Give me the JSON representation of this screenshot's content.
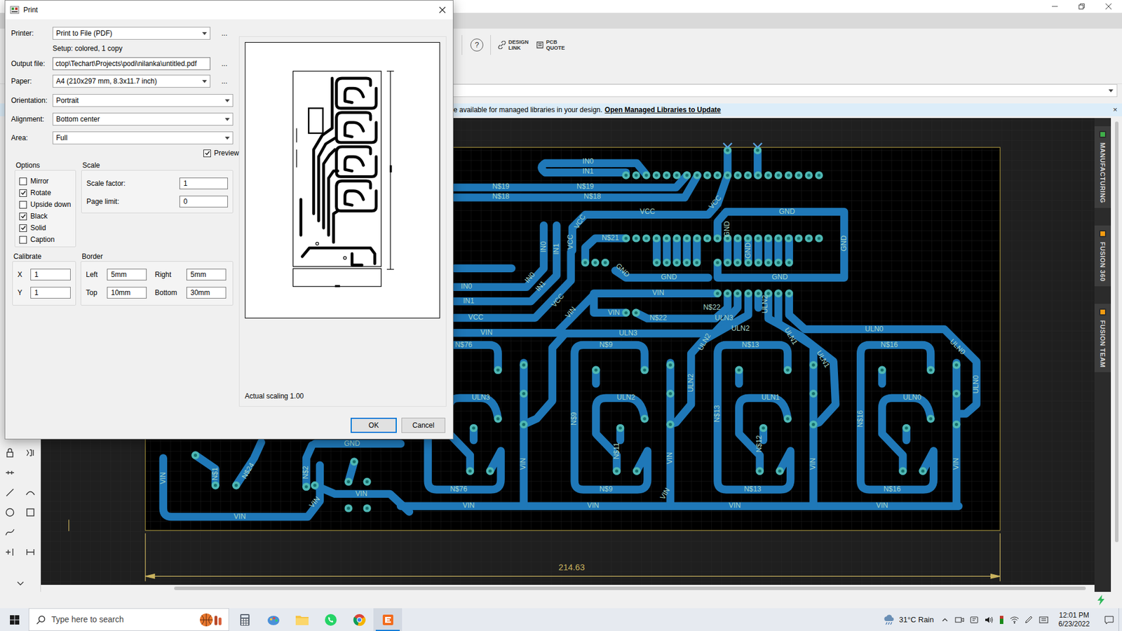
{
  "main_window": {
    "toolbar": {
      "help": "?",
      "buttons": [
        {
          "lines": [
            "DESIGN",
            "LINK"
          ]
        },
        {
          "lines": [
            "PCB",
            "QUOTE"
          ]
        }
      ]
    },
    "info_bar": {
      "text": "e available for managed libraries in your design.",
      "link": "Open Managed Libraries to Update",
      "close": "×"
    },
    "side_tabs": [
      {
        "label": "MANUFACTURING",
        "color": "#3fae49"
      },
      {
        "label": "FUSION 360",
        "color": "#f39c12"
      },
      {
        "label": "FUSION TEAM",
        "color": "#f39c12"
      }
    ],
    "pcb": {
      "labels": [
        "IN0",
        "IN1",
        "N$19",
        "N$19",
        "N$18",
        "N$18",
        "VCC",
        "VCC",
        "GND",
        "GND",
        "N$21",
        "GND",
        "GND",
        "IN0",
        "IN1",
        "VCC",
        "VCC",
        "GND",
        "GND",
        "GND",
        "IN0",
        "IN1",
        "IN0",
        "IN1",
        "VCC",
        "VCC",
        "VIN",
        "VIN",
        "VIN",
        "N$22",
        "N$22",
        "ULN3",
        "VIN",
        "ULN3",
        "ULN2",
        "ULN2",
        "ULN2",
        "ULN1",
        "ULN1",
        "ULN0",
        "ULN0",
        "N$76",
        "N$9",
        "N$13",
        "N$16",
        "ULN3",
        "ULN2",
        "ULN1",
        "ULN0",
        "ULN2",
        "ULN0",
        "N$9",
        "N$13",
        "N$16",
        "N$11",
        "N$12",
        "VIN",
        "VIN",
        "VIN",
        "VIN",
        "GND",
        "VIN",
        "N$1",
        "N$24",
        "N$2",
        "VIN",
        "N$76",
        "N$9",
        "N$13",
        "N$16",
        "VIN",
        "VIN",
        "VIN",
        "VIN",
        "VIN",
        "VIN",
        "VIN"
      ],
      "dimension": "214.63"
    }
  },
  "print_dialog": {
    "title": "Print",
    "printer": {
      "label": "Printer:",
      "value": "Print to File (PDF)",
      "more": "..."
    },
    "setup": "Setup: colored, 1 copy",
    "output_file": {
      "label": "Output file:",
      "value": "ctop\\Techart\\Projects\\podi\\nilanka\\untitled.pdf",
      "more": "..."
    },
    "paper": {
      "label": "Paper:",
      "value": "A4 (210x297 mm, 8.3x11.7 inch)",
      "more": "..."
    },
    "orientation": {
      "label": "Orientation:",
      "value": "Portrait"
    },
    "alignment": {
      "label": "Alignment:",
      "value": "Bottom center"
    },
    "area": {
      "label": "Area:",
      "value": "Full"
    },
    "preview": {
      "label": "Preview",
      "checked": true
    },
    "options": {
      "title": "Options",
      "items": [
        {
          "label": "Mirror",
          "checked": false
        },
        {
          "label": "Rotate",
          "checked": true
        },
        {
          "label": "Upside down",
          "checked": false
        },
        {
          "label": "Black",
          "checked": true
        },
        {
          "label": "Solid",
          "checked": true
        },
        {
          "label": "Caption",
          "checked": false
        }
      ]
    },
    "scale": {
      "title": "Scale",
      "fields": [
        {
          "label": "Scale factor:",
          "value": "1"
        },
        {
          "label": "Page limit:",
          "value": "0"
        }
      ]
    },
    "calibrate": {
      "title": "Calibrate",
      "fields": [
        {
          "label": "X",
          "value": "1"
        },
        {
          "label": "Y",
          "value": "1"
        }
      ]
    },
    "border": {
      "title": "Border",
      "fields": [
        {
          "label": "Left",
          "value": "5mm"
        },
        {
          "label": "Right",
          "value": "5mm"
        },
        {
          "label": "Top",
          "value": "10mm"
        },
        {
          "label": "Bottom",
          "value": "30mm"
        }
      ]
    },
    "scaling": "Actual scaling 1.00",
    "buttons": [
      {
        "label": "OK",
        "default": true
      },
      {
        "label": "Cancel",
        "default": false
      }
    ]
  },
  "taskbar": {
    "search_placeholder": "Type here to search",
    "apps": [
      {
        "kind": "calculator",
        "active": false
      },
      {
        "kind": "paint",
        "active": false
      },
      {
        "kind": "explorer",
        "active": false
      },
      {
        "kind": "whatsapp",
        "active": false
      },
      {
        "kind": "chrome",
        "active": false
      },
      {
        "kind": "eagle",
        "active": true
      }
    ],
    "weather": "31°C Rain",
    "time": "12:01 PM",
    "date": "6/23/2022"
  }
}
